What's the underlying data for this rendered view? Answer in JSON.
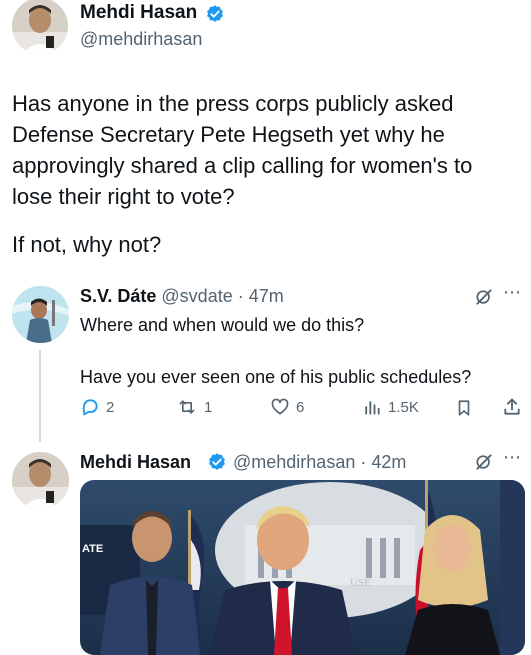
{
  "main_tweet": {
    "author_name": "Mehdi Hasan",
    "handle": "@mehdirhasan",
    "text_line_1": "Has anyone in the press corps publicly asked",
    "text_line_2": "Defense Secretary Pete Hegseth yet why he",
    "text_line_3": "approvingly shared a clip calling for women's to",
    "text_line_4": "lose their right to vote?",
    "text_line_5": "If not, why not?"
  },
  "reply_1": {
    "author_name": "S.V. Dáte",
    "handle_time": "@svdate · 47m",
    "text_line_1": "Where and when would we do this?",
    "text_line_2": "Have you ever seen one of his public schedules?",
    "actions": {
      "replies": "2",
      "reposts": "1",
      "likes": "6",
      "views": "1.5K"
    }
  },
  "reply_2": {
    "author_name": "Mehdi Hasan",
    "handle_time": "@mehdirhasan · 42m",
    "photo_sign_left": "ATE",
    "photo_sign_right": "USE"
  },
  "colors": {
    "text": "#0f1419",
    "muted": "#536471",
    "verified": "#1d9bf0",
    "thread_line": "#cfd9de"
  }
}
